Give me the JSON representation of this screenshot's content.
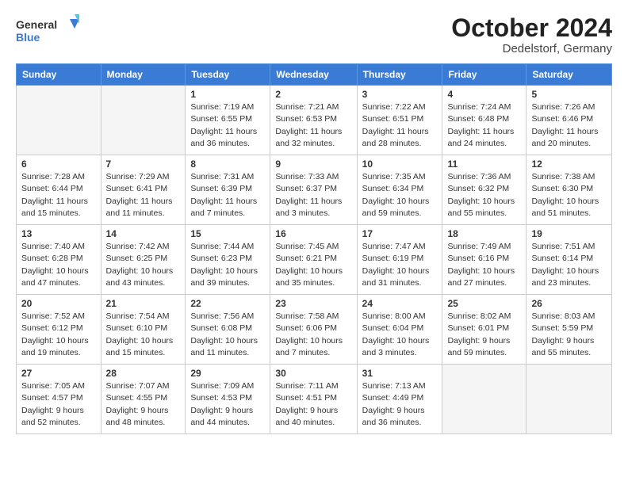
{
  "header": {
    "logo_line1": "General",
    "logo_line2": "Blue",
    "month": "October 2024",
    "location": "Dedelstorf, Germany"
  },
  "weekdays": [
    "Sunday",
    "Monday",
    "Tuesday",
    "Wednesday",
    "Thursday",
    "Friday",
    "Saturday"
  ],
  "weeks": [
    [
      {
        "day": "",
        "info": ""
      },
      {
        "day": "",
        "info": ""
      },
      {
        "day": "1",
        "info": "Sunrise: 7:19 AM\nSunset: 6:55 PM\nDaylight: 11 hours and 36 minutes."
      },
      {
        "day": "2",
        "info": "Sunrise: 7:21 AM\nSunset: 6:53 PM\nDaylight: 11 hours and 32 minutes."
      },
      {
        "day": "3",
        "info": "Sunrise: 7:22 AM\nSunset: 6:51 PM\nDaylight: 11 hours and 28 minutes."
      },
      {
        "day": "4",
        "info": "Sunrise: 7:24 AM\nSunset: 6:48 PM\nDaylight: 11 hours and 24 minutes."
      },
      {
        "day": "5",
        "info": "Sunrise: 7:26 AM\nSunset: 6:46 PM\nDaylight: 11 hours and 20 minutes."
      }
    ],
    [
      {
        "day": "6",
        "info": "Sunrise: 7:28 AM\nSunset: 6:44 PM\nDaylight: 11 hours and 15 minutes."
      },
      {
        "day": "7",
        "info": "Sunrise: 7:29 AM\nSunset: 6:41 PM\nDaylight: 11 hours and 11 minutes."
      },
      {
        "day": "8",
        "info": "Sunrise: 7:31 AM\nSunset: 6:39 PM\nDaylight: 11 hours and 7 minutes."
      },
      {
        "day": "9",
        "info": "Sunrise: 7:33 AM\nSunset: 6:37 PM\nDaylight: 11 hours and 3 minutes."
      },
      {
        "day": "10",
        "info": "Sunrise: 7:35 AM\nSunset: 6:34 PM\nDaylight: 10 hours and 59 minutes."
      },
      {
        "day": "11",
        "info": "Sunrise: 7:36 AM\nSunset: 6:32 PM\nDaylight: 10 hours and 55 minutes."
      },
      {
        "day": "12",
        "info": "Sunrise: 7:38 AM\nSunset: 6:30 PM\nDaylight: 10 hours and 51 minutes."
      }
    ],
    [
      {
        "day": "13",
        "info": "Sunrise: 7:40 AM\nSunset: 6:28 PM\nDaylight: 10 hours and 47 minutes."
      },
      {
        "day": "14",
        "info": "Sunrise: 7:42 AM\nSunset: 6:25 PM\nDaylight: 10 hours and 43 minutes."
      },
      {
        "day": "15",
        "info": "Sunrise: 7:44 AM\nSunset: 6:23 PM\nDaylight: 10 hours and 39 minutes."
      },
      {
        "day": "16",
        "info": "Sunrise: 7:45 AM\nSunset: 6:21 PM\nDaylight: 10 hours and 35 minutes."
      },
      {
        "day": "17",
        "info": "Sunrise: 7:47 AM\nSunset: 6:19 PM\nDaylight: 10 hours and 31 minutes."
      },
      {
        "day": "18",
        "info": "Sunrise: 7:49 AM\nSunset: 6:16 PM\nDaylight: 10 hours and 27 minutes."
      },
      {
        "day": "19",
        "info": "Sunrise: 7:51 AM\nSunset: 6:14 PM\nDaylight: 10 hours and 23 minutes."
      }
    ],
    [
      {
        "day": "20",
        "info": "Sunrise: 7:52 AM\nSunset: 6:12 PM\nDaylight: 10 hours and 19 minutes."
      },
      {
        "day": "21",
        "info": "Sunrise: 7:54 AM\nSunset: 6:10 PM\nDaylight: 10 hours and 15 minutes."
      },
      {
        "day": "22",
        "info": "Sunrise: 7:56 AM\nSunset: 6:08 PM\nDaylight: 10 hours and 11 minutes."
      },
      {
        "day": "23",
        "info": "Sunrise: 7:58 AM\nSunset: 6:06 PM\nDaylight: 10 hours and 7 minutes."
      },
      {
        "day": "24",
        "info": "Sunrise: 8:00 AM\nSunset: 6:04 PM\nDaylight: 10 hours and 3 minutes."
      },
      {
        "day": "25",
        "info": "Sunrise: 8:02 AM\nSunset: 6:01 PM\nDaylight: 9 hours and 59 minutes."
      },
      {
        "day": "26",
        "info": "Sunrise: 8:03 AM\nSunset: 5:59 PM\nDaylight: 9 hours and 55 minutes."
      }
    ],
    [
      {
        "day": "27",
        "info": "Sunrise: 7:05 AM\nSunset: 4:57 PM\nDaylight: 9 hours and 52 minutes."
      },
      {
        "day": "28",
        "info": "Sunrise: 7:07 AM\nSunset: 4:55 PM\nDaylight: 9 hours and 48 minutes."
      },
      {
        "day": "29",
        "info": "Sunrise: 7:09 AM\nSunset: 4:53 PM\nDaylight: 9 hours and 44 minutes."
      },
      {
        "day": "30",
        "info": "Sunrise: 7:11 AM\nSunset: 4:51 PM\nDaylight: 9 hours and 40 minutes."
      },
      {
        "day": "31",
        "info": "Sunrise: 7:13 AM\nSunset: 4:49 PM\nDaylight: 9 hours and 36 minutes."
      },
      {
        "day": "",
        "info": ""
      },
      {
        "day": "",
        "info": ""
      }
    ]
  ]
}
